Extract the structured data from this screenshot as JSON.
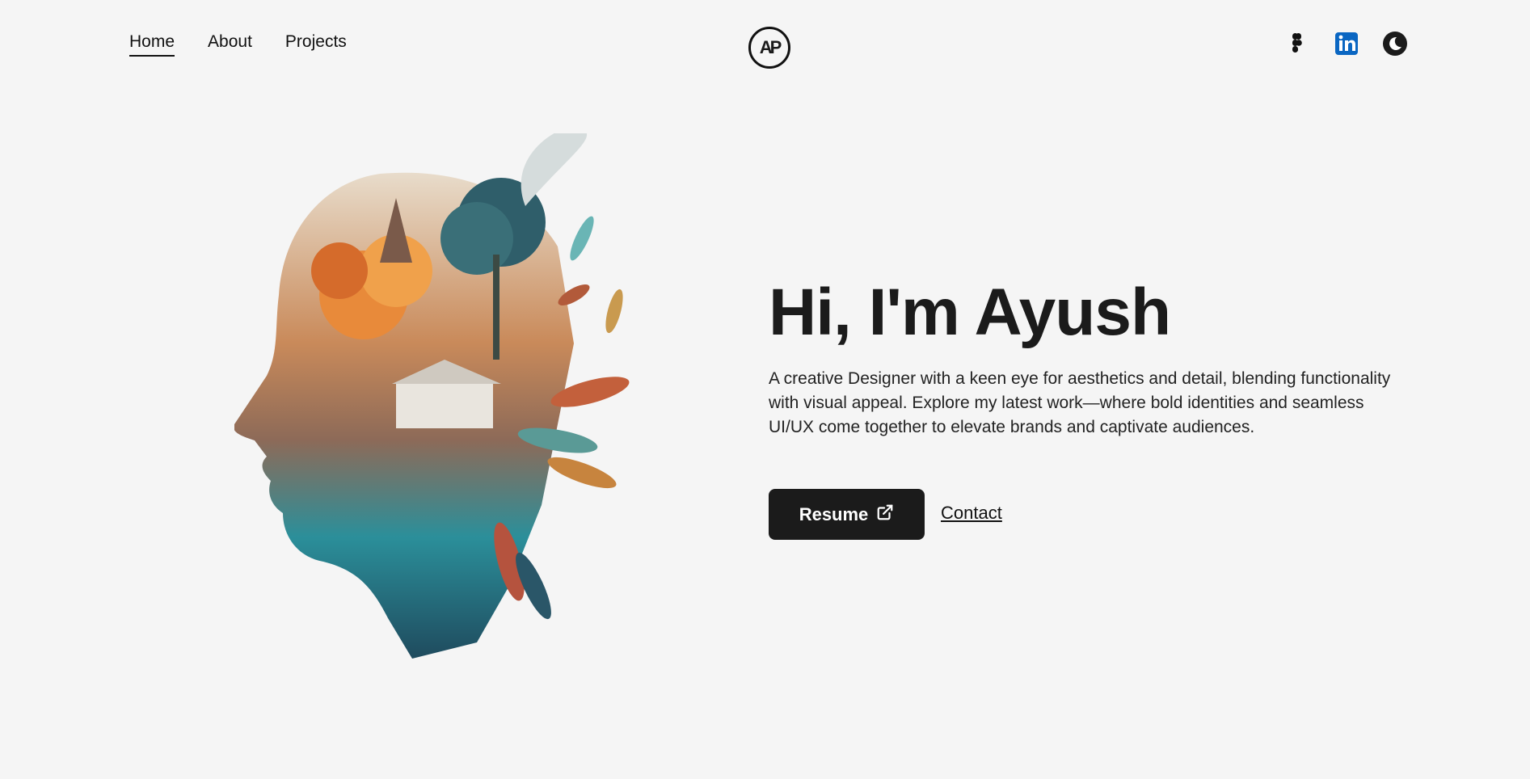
{
  "nav": {
    "items": [
      {
        "label": "Home",
        "active": true
      },
      {
        "label": "About"
      },
      {
        "label": "Projects"
      }
    ]
  },
  "logo": {
    "text": "AP"
  },
  "social": [
    {
      "icon": "figma-icon"
    },
    {
      "icon": "linkedin-icon",
      "color": "#0a66c2"
    },
    {
      "icon": "dark-mode-icon"
    }
  ],
  "hero": {
    "title": "Hi, I'm Ayush",
    "description": "A creative Designer with a keen eye for aesthetics and detail, blending functionality with visual appeal. Explore my latest work—where bold identities and seamless UI/UX come together to elevate brands and captivate audiences.",
    "resume_label": "Resume",
    "contact_label": "Contact"
  }
}
